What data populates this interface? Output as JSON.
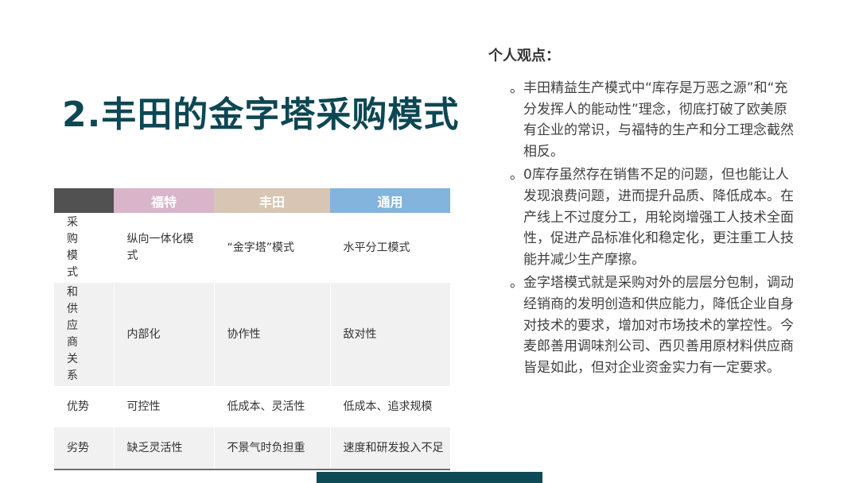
{
  "title": "2.丰田的金字塔采购模式",
  "table": {
    "headers": [
      "",
      "福特",
      "丰田",
      "通用"
    ],
    "rows": [
      [
        "采购模式",
        "纵向一体化模式",
        "“金字塔”模式",
        "水平分工模式"
      ],
      [
        "和供应商关系",
        "内部化",
        "协作性",
        "敌对性"
      ],
      [
        "优势",
        "可控性",
        "低成本、灵活性",
        "低成本、追求规模"
      ],
      [
        "劣势",
        "缺乏灵活性",
        "不景气时负担重",
        "速度和研发投入不足"
      ]
    ]
  },
  "opinion": {
    "heading": "个人观点：",
    "bullet": "。",
    "points": [
      "丰田精益生产模式中“库存是万恶之源”和“充分发挥人的能动性”理念，彻底打破了欧美原有企业的常识，与福特的生产和分工理念截然相反。",
      "0库存虽然存在销售不足的问题，但也能让人发现浪费问题，进而提升品质、降低成本。在产线上不过度分工，用轮岗增强工人技术全面性，促进产品标准化和稳定化，更注重工人技能并减少生产摩擦。",
      "金字塔模式就是采购对外的层层分包制，调动经销商的发明创造和供应能力，降低企业自身对技术的要求，增加对市场技术的掌控性。今麦郎善用调味剂公司、西贝善用原材料供应商皆是如此，但对企业资金实力有一定要求。"
    ]
  },
  "colors": {
    "title": "#0d4753",
    "header_dark": "#515151",
    "header_ford": "#d9b5c9",
    "header_toyota": "#d7c6b3",
    "header_gm": "#82b4de",
    "footer_bar": "#0f4a57"
  }
}
